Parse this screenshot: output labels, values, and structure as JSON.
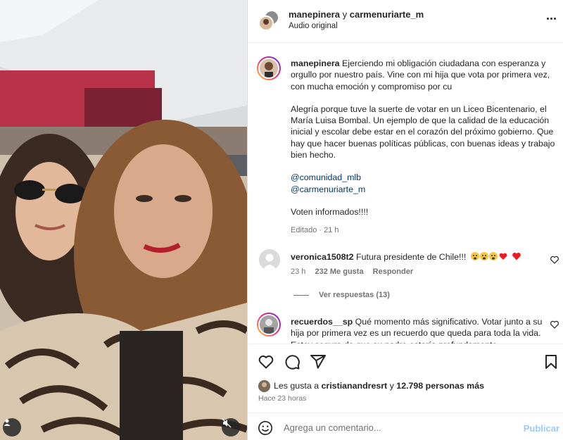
{
  "header": {
    "user1": "manepinera",
    "conj": "y",
    "user2": "carmenuriarte_m",
    "audio": "Audio original"
  },
  "caption": {
    "username": "manepinera",
    "para1": "Ejerciendo mi obligación ciudadana con esperanza y orgullo por nuestro país. Vine con mi hija que vota por primera vez, con mucha emoción y compromiso por cu",
    "para2": "Alegría porque tuve la suerte de votar en un Liceo Bicentenario, el María Luisa Bombal. Un ejemplo de que la calidad de la educación inicial y escolar debe estar en el corazón del próximo gobierno. Que hay que hacer buenas políticas públicas, con buenas ideas y trabajo bien hecho.",
    "mention1": "@comunidad_mlb",
    "mention2": "@carmenuriarte_m",
    "para3": "Voten informados!!!!",
    "meta": "Editado · 21 h"
  },
  "comments": [
    {
      "username": "veronica1508t2",
      "text": "Futura presidente de Chile!!!",
      "time": "23 h",
      "likes": "232 Me gusta",
      "reply": "Responder",
      "replies": "Ver respuestas (13)"
    },
    {
      "username": "recuerdos__sp",
      "text": "Qué momento más significativo. Votar junto a su hija por primera vez es un recuerdo que queda para toda la vida. Estoy segura de que su padre estaría profundamente"
    }
  ],
  "likes": {
    "prefix": "Les gusta a",
    "user": "cristianandresrt",
    "conj": "y",
    "count": "12.798 personas más"
  },
  "time_ago": "Hace 23 horas",
  "composer": {
    "placeholder": "Agrega un comentario...",
    "publish": "Publicar"
  },
  "colors": {
    "link": "#00376b",
    "muted": "#737373",
    "publish": "#9ec9f5",
    "heart_red": "#ed1c24"
  }
}
